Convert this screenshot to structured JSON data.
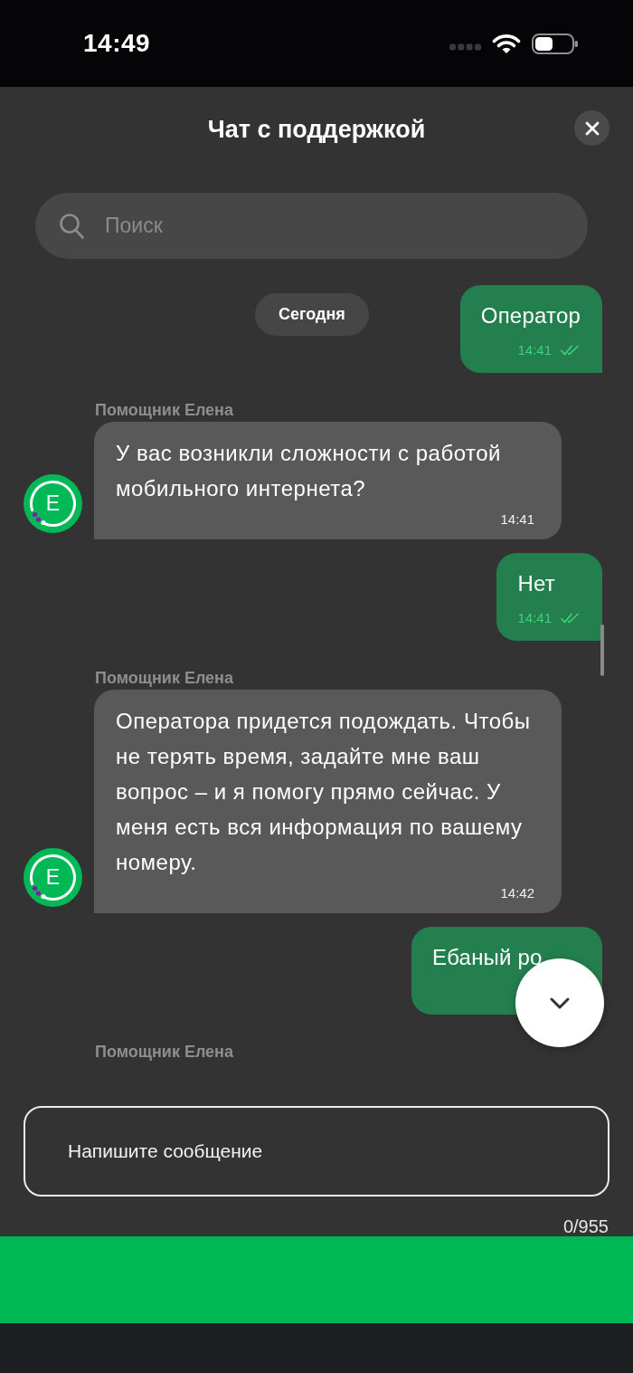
{
  "status_bar": {
    "time": "14:49"
  },
  "header": {
    "title": "Чат с поддержкой"
  },
  "search": {
    "placeholder": "Поиск"
  },
  "date_label": "Сегодня",
  "messages": [
    {
      "kind": "outgoing",
      "text": "Оператор",
      "time": "14:41",
      "read": true
    },
    {
      "kind": "incoming",
      "sender": "Помощник Елена",
      "avatar": "Е",
      "text": "У вас возникли сложности с работой мобильного интернета?",
      "time": "14:41"
    },
    {
      "kind": "outgoing",
      "text": "Нет",
      "time": "14:41",
      "read": true
    },
    {
      "kind": "incoming",
      "sender": "Помощник Елена",
      "avatar": "Е",
      "text": "Оператора придется подождать. Чтобы не терять время, задайте мне ваш вопрос – и я помогу прямо сейчас. У меня есть вся информация по вашему номеру.",
      "time": "14:42"
    },
    {
      "kind": "outgoing",
      "text": "Ебаный ро"
    },
    {
      "kind": "incoming",
      "sender": "Помощник Елена"
    }
  ],
  "composer": {
    "placeholder": "Напишите сообщение",
    "counter": "0/955"
  }
}
